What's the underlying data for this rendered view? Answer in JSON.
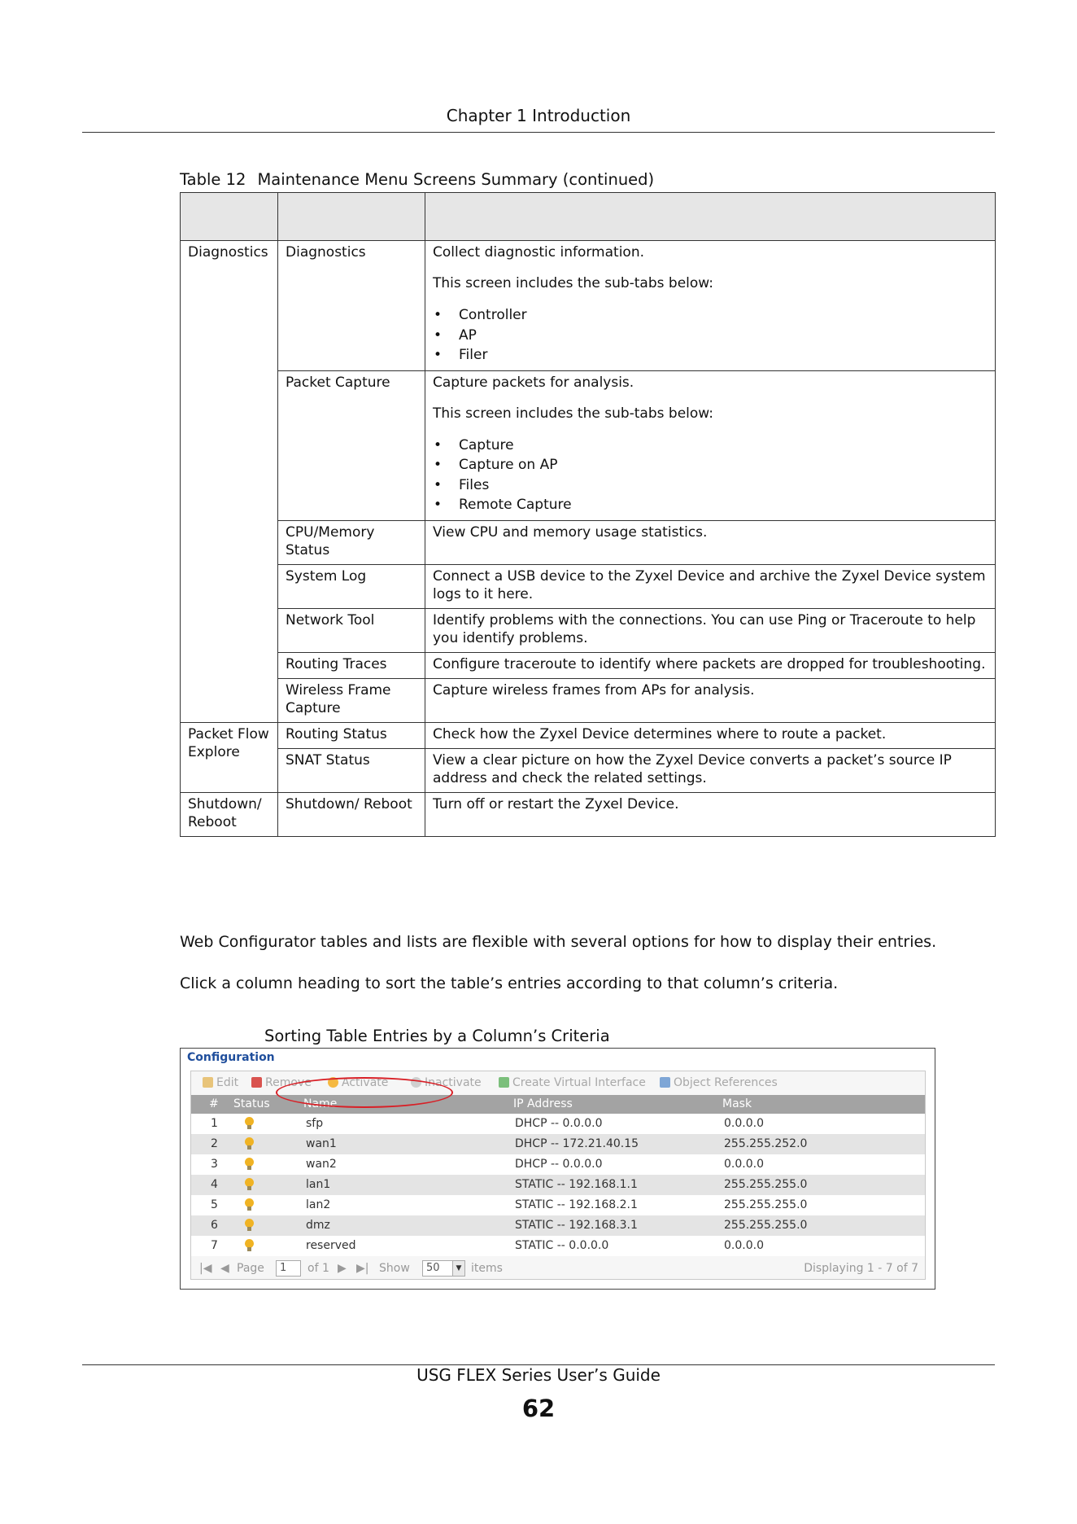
{
  "header": {
    "chapter": "Chapter 1 Introduction"
  },
  "table": {
    "caption_number": "Table 12",
    "caption_text": "Maintenance Menu Screens Summary (continued)",
    "header_row": [
      "",
      "",
      ""
    ],
    "rows": [
      {
        "col1": "Diagnostics",
        "col2": "Diagnostics",
        "desc": [
          "Collect diagnostic information.",
          "This screen includes the sub-tabs below:"
        ],
        "bullets": [
          "Controller",
          "AP",
          "Filer"
        ]
      },
      {
        "col2": "Packet Capture",
        "desc": [
          "Capture packets for analysis.",
          "This screen includes the sub-tabs below:"
        ],
        "bullets": [
          "Capture",
          "Capture on AP",
          "Files",
          "Remote Capture"
        ]
      },
      {
        "col2": "CPU/Memory Status",
        "desc": [
          "View CPU and memory usage statistics."
        ]
      },
      {
        "col2": "System Log",
        "desc": [
          "Connect a USB device to the Zyxel Device and archive the Zyxel Device system logs to it here."
        ]
      },
      {
        "col2": "Network Tool",
        "desc": [
          "Identify problems with the connections. You can use Ping or Traceroute to help you identify problems."
        ]
      },
      {
        "col2": "Routing Traces",
        "desc": [
          "Configure traceroute to identify where packets are dropped for troubleshooting."
        ]
      },
      {
        "col2": "Wireless Frame Capture",
        "desc": [
          "Capture wireless frames from APs for analysis."
        ]
      },
      {
        "col1": "Packet Flow Explore",
        "col2": "Routing Status",
        "desc": [
          "Check how the Zyxel Device determines where to route a packet."
        ]
      },
      {
        "col2": "SNAT Status",
        "desc": [
          "View a clear picture on how the Zyxel Device converts a packet’s source IP address and check the related settings."
        ]
      },
      {
        "col1": "Shutdown/ Reboot",
        "col2": "Shutdown/ Reboot",
        "desc": [
          "Turn off or restart the Zyxel Device."
        ]
      }
    ]
  },
  "paragraphs": [
    "Web Configurator tables and lists are flexible with several options for how to display their entries.",
    "Click a column heading to sort the table’s entries according to that column’s criteria."
  ],
  "figure": {
    "title": "Sorting Table Entries by a Column’s Criteria",
    "screenshot": {
      "panel_title": "Configuration",
      "toolbar": [
        {
          "label": "Edit",
          "icon": "edit-icon"
        },
        {
          "label": "Remove",
          "icon": "remove-icon"
        },
        {
          "label": "Activate",
          "icon": "activate-bulb-icon"
        },
        {
          "label": "Inactivate",
          "icon": "inactivate-bulb-icon"
        },
        {
          "label": "Create Virtual Interface",
          "icon": "virtual-interface-icon"
        },
        {
          "label": "Object References",
          "icon": "object-references-icon"
        }
      ],
      "columns": [
        "#",
        "Status",
        "Name",
        "IP Address",
        "Mask"
      ],
      "rows": [
        {
          "num": "1",
          "name": "sfp",
          "ip": "DHCP -- 0.0.0.0",
          "mask": "0.0.0.0"
        },
        {
          "num": "2",
          "name": "wan1",
          "ip": "DHCP -- 172.21.40.15",
          "mask": "255.255.252.0"
        },
        {
          "num": "3",
          "name": "wan2",
          "ip": "DHCP -- 0.0.0.0",
          "mask": "0.0.0.0"
        },
        {
          "num": "4",
          "name": "lan1",
          "ip": "STATIC -- 192.168.1.1",
          "mask": "255.255.255.0"
        },
        {
          "num": "5",
          "name": "lan2",
          "ip": "STATIC -- 192.168.2.1",
          "mask": "255.255.255.0"
        },
        {
          "num": "6",
          "name": "dmz",
          "ip": "STATIC -- 192.168.3.1",
          "mask": "255.255.255.0"
        },
        {
          "num": "7",
          "name": "reserved",
          "ip": "STATIC -- 0.0.0.0",
          "mask": "0.0.0.0"
        }
      ],
      "pager": {
        "first": "|◀",
        "prev": "◀",
        "page_label": "Page",
        "page_value": "1",
        "of_label": "of 1",
        "next": "▶",
        "last": "▶|",
        "show_label": "Show",
        "show_value": "50",
        "items_label": "items",
        "displaying": "Displaying 1 - 7 of 7"
      }
    }
  },
  "footer": {
    "guide": "USG FLEX Series User’s Guide",
    "page_number": "62"
  },
  "colors": {
    "highlight_ellipse": "#d81f26",
    "panel_title": "#1f4e9c",
    "grid_header": "#a3a3a3"
  }
}
